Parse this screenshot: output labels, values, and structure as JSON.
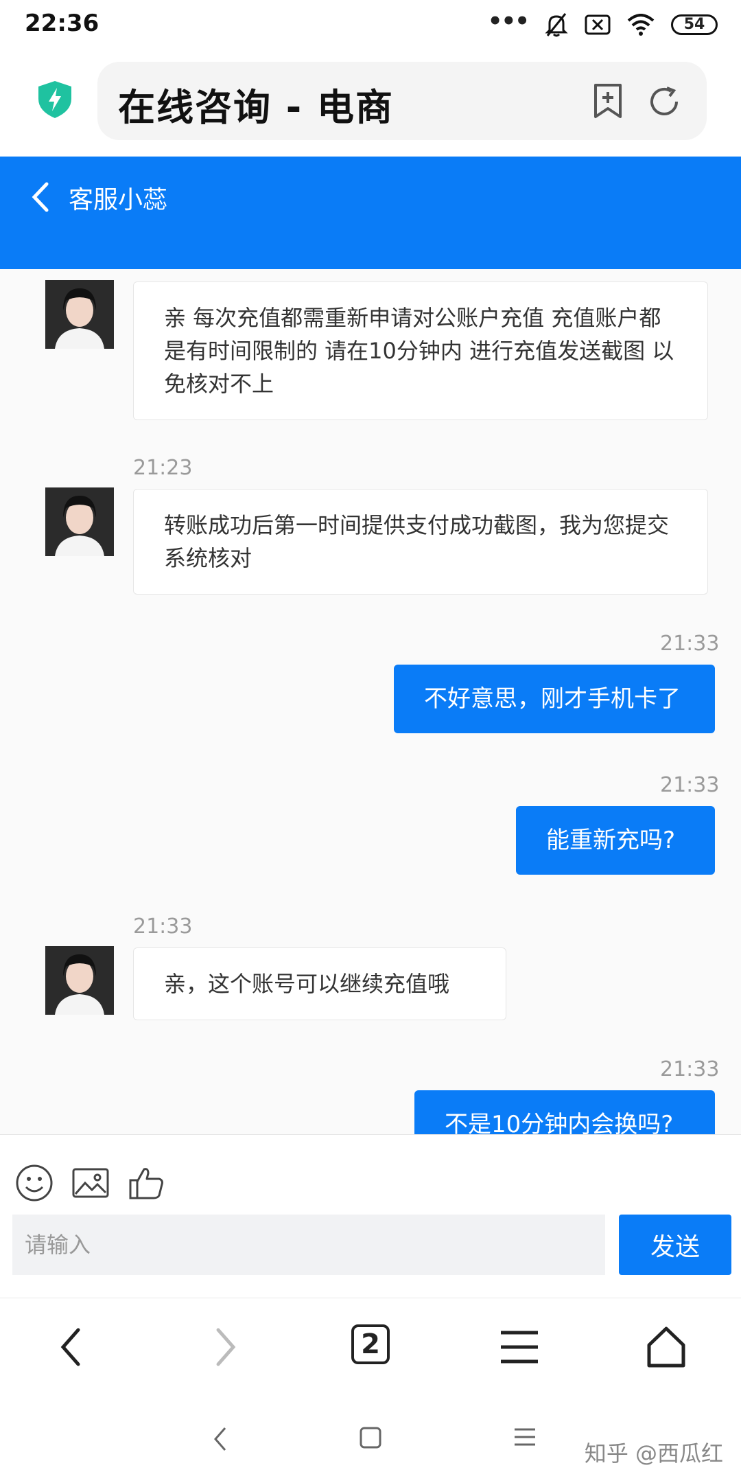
{
  "status_bar": {
    "time": "22:36",
    "dots": "•••",
    "battery": "54"
  },
  "address_bar": {
    "url_text": "在线咨询 - 电商"
  },
  "header": {
    "title": "客服小蕊"
  },
  "messages": [
    {
      "side": "in",
      "time": "",
      "text": "亲 每次充值都需重新申请对公账户充值 充值账户都是有时间限制的 请在10分钟内 进行充值发送截图 以免核对不上"
    },
    {
      "side": "in",
      "time": "21:23",
      "text": "转账成功后第一时间提供支付成功截图，我为您提交系统核对"
    },
    {
      "side": "out",
      "time": "21:33",
      "text": "不好意思，刚才手机卡了"
    },
    {
      "side": "out",
      "time": "21:33",
      "text": "能重新充吗?"
    },
    {
      "side": "in",
      "time": "21:33",
      "text": "亲，这个账号可以继续充值哦"
    },
    {
      "side": "out",
      "time": "21:33",
      "text": "不是10分钟内会换吗?"
    }
  ],
  "composer": {
    "placeholder": "请输入",
    "send_label": "发送"
  },
  "browser_nav": {
    "tab_count": "2"
  },
  "watermark": "知乎 @西瓜红",
  "colors": {
    "accent": "#0a7cf7",
    "shield": "#1fc2a0"
  }
}
